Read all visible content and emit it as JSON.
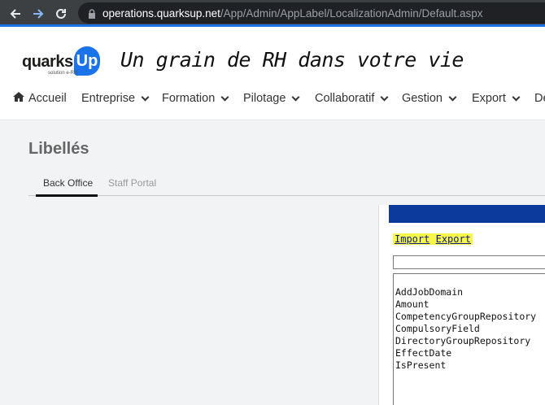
{
  "browser": {
    "url_host": "operations.quarksup.net",
    "url_path": "/App/Admin/AppLabel/LocalizationAdmin/Default.aspx"
  },
  "header": {
    "logo_text": "quarks",
    "logo_badge": "Up",
    "logo_subtitle": "solution e-RH",
    "tagline": "Un grain de RH dans votre vie"
  },
  "menu": {
    "items": [
      {
        "label": "Accueil"
      },
      {
        "label": "Entreprise"
      },
      {
        "label": "Formation"
      },
      {
        "label": "Pilotage"
      },
      {
        "label": "Collaboratif"
      },
      {
        "label": "Gestion"
      },
      {
        "label": "Export"
      },
      {
        "label": "De"
      }
    ]
  },
  "page": {
    "title": "Libellés",
    "tabs": [
      {
        "label": "Back Office",
        "active": true
      },
      {
        "label": "Staff Portal",
        "active": false
      }
    ]
  },
  "panel": {
    "import_label": "Import",
    "export_label": "Export",
    "search_value": "",
    "list_items": [
      "AddJobDomain",
      "Amount",
      "CompetencyGroupRepository",
      "CompulsoryField",
      "DirectoryGroupRepository",
      "EffectDate",
      "IsPresent"
    ]
  },
  "colors": {
    "accent": "#1a73e8",
    "panel_bar": "#0c3a9c",
    "highlight": "#f7f74a"
  }
}
